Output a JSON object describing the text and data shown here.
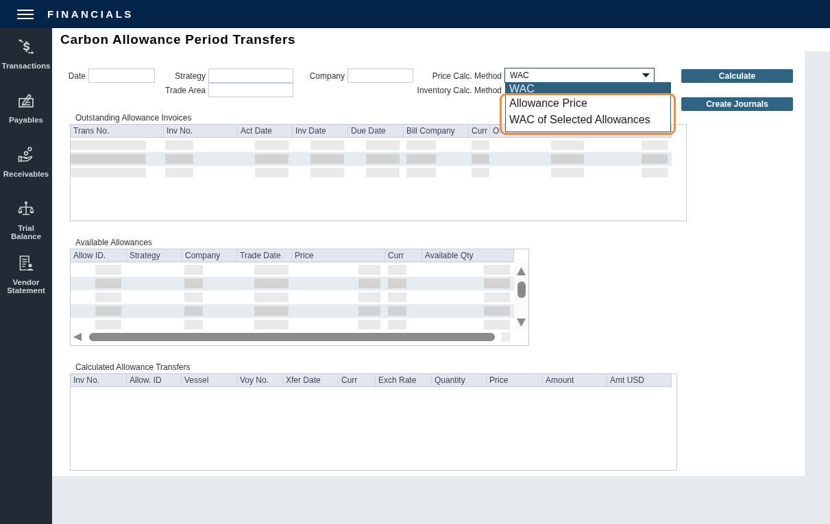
{
  "app_bar": {
    "title": "FINANCIALS"
  },
  "sidebar": {
    "items": [
      {
        "label": "Transactions",
        "selected": false
      },
      {
        "label": "Payables",
        "selected": false
      },
      {
        "label": "Receivables",
        "selected": false
      },
      {
        "label": "Trial Balance",
        "selected": false
      },
      {
        "label": "Vendor Statement",
        "selected": false
      }
    ]
  },
  "page": {
    "title": "Carbon Allowance Period Transfers"
  },
  "form": {
    "field_groups": [
      {
        "fields": [
          {
            "label": "Date",
            "kind": "text"
          }
        ]
      },
      {
        "fields": [
          {
            "label": "Strategy",
            "kind": "text"
          },
          {
            "label": "Trade Area",
            "kind": "text"
          }
        ]
      },
      {
        "fields": [
          {
            "label": "Company",
            "kind": "text"
          }
        ]
      },
      {
        "fields": [
          {
            "label": "Price Calc. Method",
            "kind": "select",
            "value": "WAC",
            "expanded": true,
            "options": [
              {
                "label": "WAC",
                "selected": true,
                "highlighted": false
              },
              {
                "label": "Allowance Price",
                "selected": false,
                "highlighted": true
              },
              {
                "label": "WAC of Selected Allowances",
                "selected": false,
                "highlighted": true
              }
            ]
          },
          {
            "label": "Inventory Calc. Method",
            "kind": "label"
          }
        ]
      }
    ],
    "buttons": [
      "Calculate",
      "Create Journals"
    ]
  },
  "tables": [
    {
      "title": "Outstanding Allowance Invoices",
      "columns": [
        "Trans No.",
        "Inv No.",
        "Act Date",
        "Inv Date",
        "Due Date",
        "Bill Company",
        "Curr",
        "O"
      ],
      "rows": [
        {
          "cells": [
            {
              "kind": "redacted"
            },
            {
              "kind": "redacted"
            },
            {
              "kind": "redacted"
            },
            {
              "kind": "redacted"
            },
            {
              "kind": "redacted"
            },
            {
              "kind": "redacted"
            },
            {
              "kind": "redacted"
            },
            {
              "kind": "redacted"
            },
            {
              "kind": "redacted"
            }
          ]
        },
        {
          "cells": [
            {
              "kind": "redacted"
            },
            {
              "kind": "redacted"
            },
            {
              "kind": "redacted"
            },
            {
              "kind": "redacted"
            },
            {
              "kind": "redacted"
            },
            {
              "kind": "redacted"
            },
            {
              "kind": "redacted"
            },
            {
              "kind": "redacted"
            },
            {
              "kind": "redacted"
            }
          ]
        },
        {
          "cells": [
            {
              "kind": "redacted"
            },
            {
              "kind": "redacted"
            },
            {
              "kind": "redacted"
            },
            {
              "kind": "redacted"
            },
            {
              "kind": "redacted"
            },
            {
              "kind": "redacted"
            },
            {
              "kind": "redacted"
            },
            {
              "kind": "redacted"
            },
            {
              "kind": "redacted"
            }
          ]
        }
      ]
    },
    {
      "title": "Available Allowances",
      "columns": [
        "Allow ID.",
        "Strategy",
        "Company",
        "Trade Date",
        "Price",
        "Curr",
        "Available Qty"
      ],
      "rows": [
        {
          "cells": [
            {
              "kind": "redacted"
            },
            {
              "kind": "empty"
            },
            {
              "kind": "redacted"
            },
            {
              "kind": "redacted"
            },
            {
              "kind": "redacted"
            },
            {
              "kind": "redacted"
            },
            {
              "kind": "redacted"
            }
          ]
        },
        {
          "cells": [
            {
              "kind": "redacted"
            },
            {
              "kind": "empty"
            },
            {
              "kind": "redacted"
            },
            {
              "kind": "redacted"
            },
            {
              "kind": "redacted"
            },
            {
              "kind": "redacted"
            },
            {
              "kind": "redacted"
            }
          ]
        },
        {
          "cells": [
            {
              "kind": "redacted"
            },
            {
              "kind": "empty"
            },
            {
              "kind": "redacted"
            },
            {
              "kind": "redacted"
            },
            {
              "kind": "redacted"
            },
            {
              "kind": "redacted"
            },
            {
              "kind": "redacted"
            }
          ]
        },
        {
          "cells": [
            {
              "kind": "redacted"
            },
            {
              "kind": "empty"
            },
            {
              "kind": "redacted"
            },
            {
              "kind": "redacted"
            },
            {
              "kind": "redacted"
            },
            {
              "kind": "redacted"
            },
            {
              "kind": "redacted"
            }
          ]
        },
        {
          "cells": [
            {
              "kind": "redacted"
            },
            {
              "kind": "empty"
            },
            {
              "kind": "redacted"
            },
            {
              "kind": "redacted"
            },
            {
              "kind": "redacted"
            },
            {
              "kind": "redacted"
            },
            {
              "kind": "redacted"
            }
          ]
        }
      ]
    },
    {
      "title": "Calculated Allowance Transfers",
      "columns": [
        "Inv No.",
        "Allow. ID",
        "Vessel",
        "Voy No.",
        "Xfer Date",
        "Curr",
        "Exch Rate",
        "Quantity",
        "Price",
        "Amount",
        "Amt USD"
      ]
    }
  ]
}
